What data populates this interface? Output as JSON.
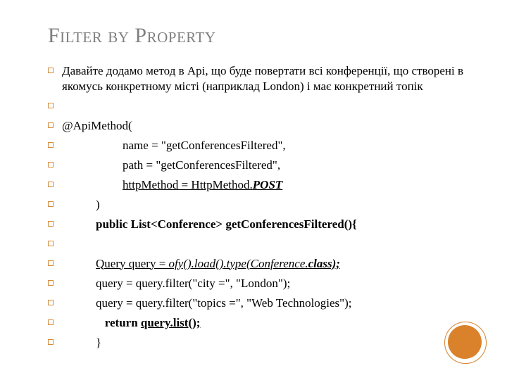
{
  "title": "Filter by Property",
  "lines": [
    {
      "html": "Давайте додамо метод в Api, що буде повертати всі конференції, що створені в якомусь конкретному місті (наприклад London) і має конкретний топік"
    },
    {
      "html": ""
    },
    {
      "html": "@ApiMethod("
    },
    {
      "html": "<span class=\"indent1\">name = \"getConferencesFiltered\",</span>"
    },
    {
      "html": "<span class=\"indent1\">path = \"getConferencesFiltered\",</span>"
    },
    {
      "html": "<span class=\"indent1 ul\">httpMethod = HttpMethod.<span class=\"bold ital\">POST</span></span>"
    },
    {
      "html": "<span class=\"indent2\">)</span>"
    },
    {
      "html": "<span class=\"indent2 bold\">public List&lt;Conference&gt; getConferencesFiltered(){</span>"
    },
    {
      "html": ""
    },
    {
      "html": "<span class=\"indent2\"><span class=\"ul\">Query query = <span class=\"ital\">ofy().load().type(Conference.<span class=\"bold\">class);</span></span></span></span>"
    },
    {
      "html": "<span class=\"indent2\">query = query.filter(\"city =\", \"London\");</span>"
    },
    {
      "html": "<span class=\"indent2\">query = query.filter(\"topics =\", \"Web Technologies\");</span>"
    },
    {
      "html": "<span class=\"indent2\">&nbsp;&nbsp;&nbsp;<span class=\"bold\">return <span class=\"ul\">query.list();</span></span></span>"
    },
    {
      "html": "<span class=\"indent2\">}</span>"
    }
  ]
}
